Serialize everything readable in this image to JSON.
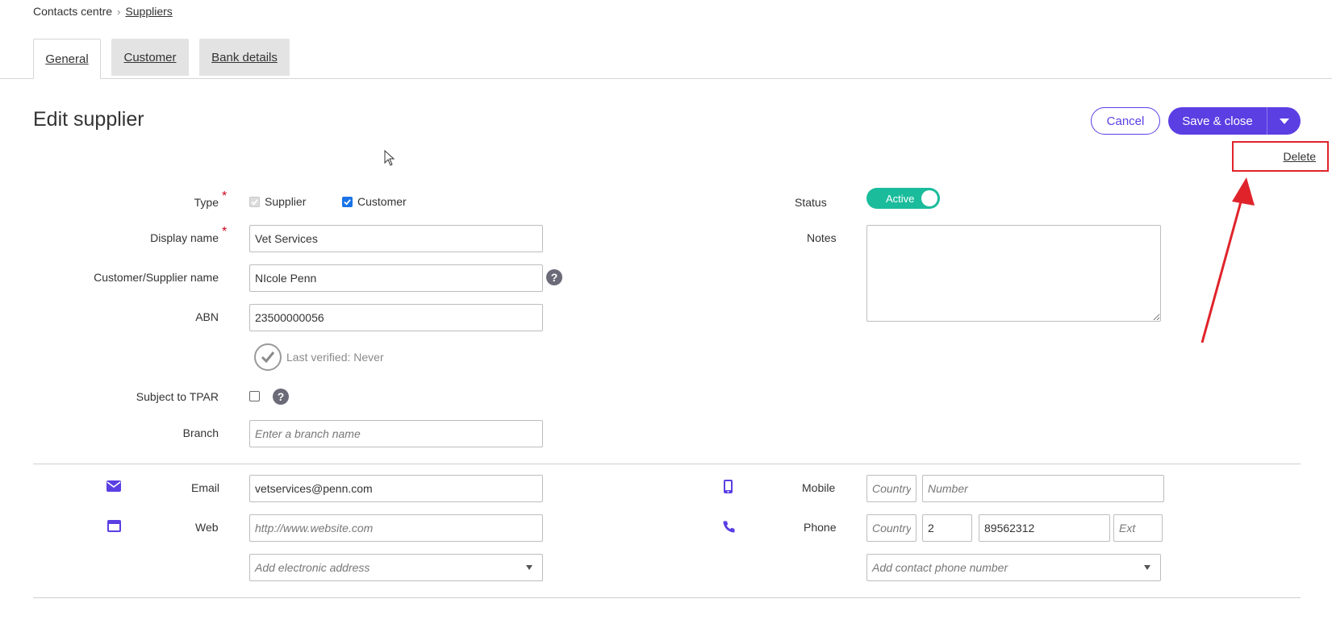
{
  "breadcrumb": {
    "root": "Contacts centre",
    "current": "Suppliers"
  },
  "tabs": [
    {
      "label": "General"
    },
    {
      "label": "Customer"
    },
    {
      "label": "Bank details"
    }
  ],
  "header": {
    "title": "Edit supplier",
    "cancel_label": "Cancel",
    "save_label": "Save & close",
    "menu_delete_label": "Delete"
  },
  "form": {
    "type_label": "Type",
    "type_supplier": "Supplier",
    "type_customer": "Customer",
    "display_name_label": "Display name",
    "display_name_value": "Vet Services",
    "cs_name_label": "Customer/Supplier name",
    "cs_name_value": "NIcole Penn",
    "abn_label": "ABN",
    "abn_value": "23500000056",
    "last_verified": "Last verified: Never",
    "tpar_label": "Subject to TPAR",
    "branch_label": "Branch",
    "branch_placeholder": "Enter a branch name",
    "status_label": "Status",
    "status_value": "Active",
    "notes_label": "Notes",
    "notes_value": ""
  },
  "contact": {
    "email_label": "Email",
    "email_value": "vetservices@penn.com",
    "web_label": "Web",
    "web_placeholder": "http://www.website.com",
    "add_electronic": "Add electronic address",
    "mobile_label": "Mobile",
    "mobile_country_placeholder": "Country",
    "mobile_number_placeholder": "Number",
    "phone_label": "Phone",
    "phone_country_placeholder": "Country",
    "phone_area": "2",
    "phone_number": "89562312",
    "phone_ext_placeholder": "Ext",
    "add_phone": "Add contact phone number"
  },
  "colors": {
    "accent": "#5b3fe3",
    "status_active": "#1abc9c",
    "annotation": "#e0232b"
  },
  "icons": [
    "help-icon",
    "envelope-icon",
    "browser-window-icon",
    "mobile-phone-icon",
    "telephone-icon",
    "checkmark-icon",
    "chevron-down-icon",
    "mouse-cursor-icon",
    "red-arrow-annotation"
  ]
}
